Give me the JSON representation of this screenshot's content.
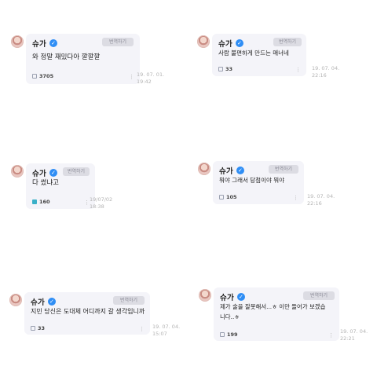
{
  "posts": [
    {
      "name": "슈가",
      "translate": "번역하기",
      "message": "와 정말 재밌다아 깔깔깔",
      "likes": "3705",
      "timestamp": "19. 07. 01.\n19:42"
    },
    {
      "name": "슈가",
      "translate": "번역하기",
      "message": "사람 불편하게 만드는 매너네",
      "likes": "33",
      "timestamp": "19. 07. 04.\n22:16"
    },
    {
      "name": "슈가",
      "translate": "번역하기",
      "message": "다 썼냐고",
      "likes": "160",
      "timestamp": "19/07/02\n18:38"
    },
    {
      "name": "슈가",
      "translate": "번역하기",
      "message": "뭐야 그래서 당첨이야 뭐야",
      "likes": "105",
      "timestamp": "19. 07. 04.\n22:16"
    },
    {
      "name": "슈가",
      "translate": "번역하기",
      "message": "지민 당신은 도대체 어디까지 갈 생각입니까",
      "likes": "33",
      "timestamp": "19. 07. 04.\n15:07"
    },
    {
      "name": "슈가",
      "translate": "번역하기",
      "message_line1": "제가 술을 잘못해서...ㅎ 이만 들어가 보겠습",
      "message_line2": "니다..ㅎ",
      "likes": "199",
      "timestamp": "19. 07. 04.\n22:21"
    }
  ],
  "icons": {
    "verified": "verified-check-icon",
    "like": "like-icon",
    "more": "more-options-icon"
  },
  "colors": {
    "bubble": "#f4f4f9",
    "verified": "#2f8ef5",
    "active_like": "#3ab0c8"
  }
}
